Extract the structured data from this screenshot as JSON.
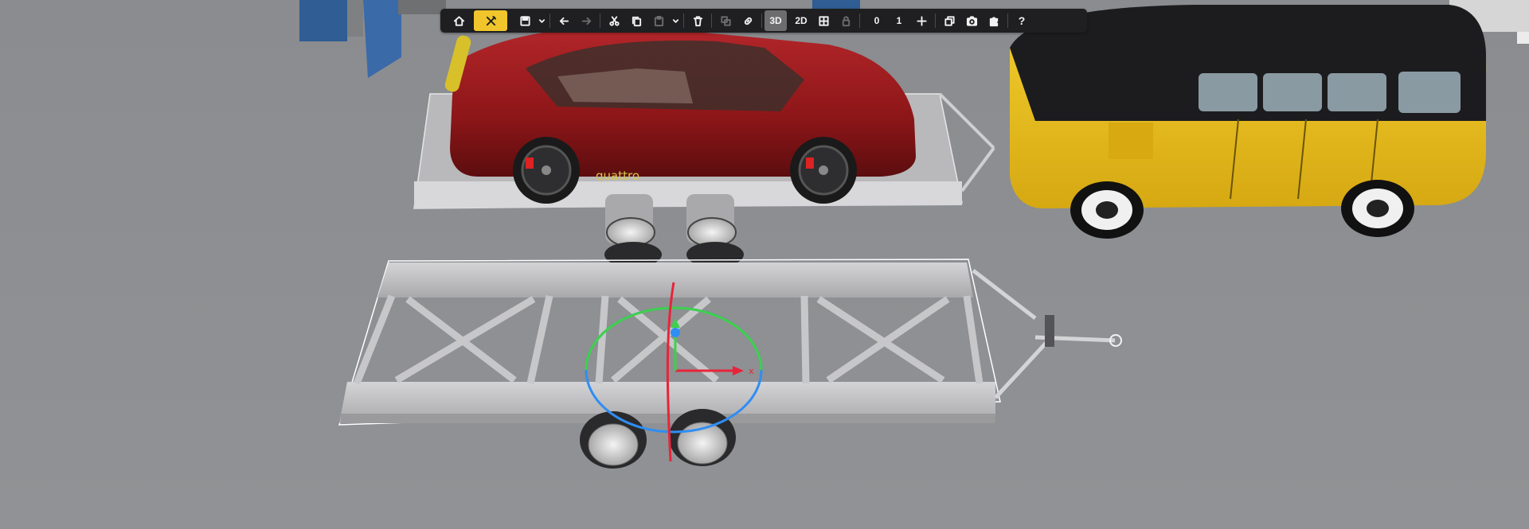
{
  "toolbar": {
    "home_icon": "home-icon",
    "tools_icon": "tools-icon",
    "save_icon": "save-icon",
    "undo_icon": "arrow-left-icon",
    "redo_icon": "arrow-right-icon",
    "cut_icon": "scissors-icon",
    "copy_icon": "copy-icon",
    "paste_icon": "paste-icon",
    "delete_icon": "trash-icon",
    "group_icon": "group-icon",
    "link_icon": "link-icon",
    "view_3d_label": "3D",
    "view_2d_label": "2D",
    "grid_icon": "grid-icon",
    "lock_icon": "lock-icon",
    "counter_a": "0",
    "counter_b": "1",
    "add_icon": "plus-icon",
    "layers_icon": "layers-icon",
    "camera_icon": "camera-icon",
    "plugin_icon": "puzzle-icon",
    "help_label": "?"
  },
  "scene": {
    "car_badge_text": "quattro",
    "gizmo_axis_label": "x",
    "colors": {
      "floor": "#8d8f92",
      "car_red": "#9b1b1e",
      "van_yellow": "#e9c11f",
      "van_black": "#1c1c1e",
      "trailer_grey": "#bdbdbf",
      "toolbar_bg": "#1f1f21",
      "toolbar_active": "#f0c62c"
    }
  }
}
